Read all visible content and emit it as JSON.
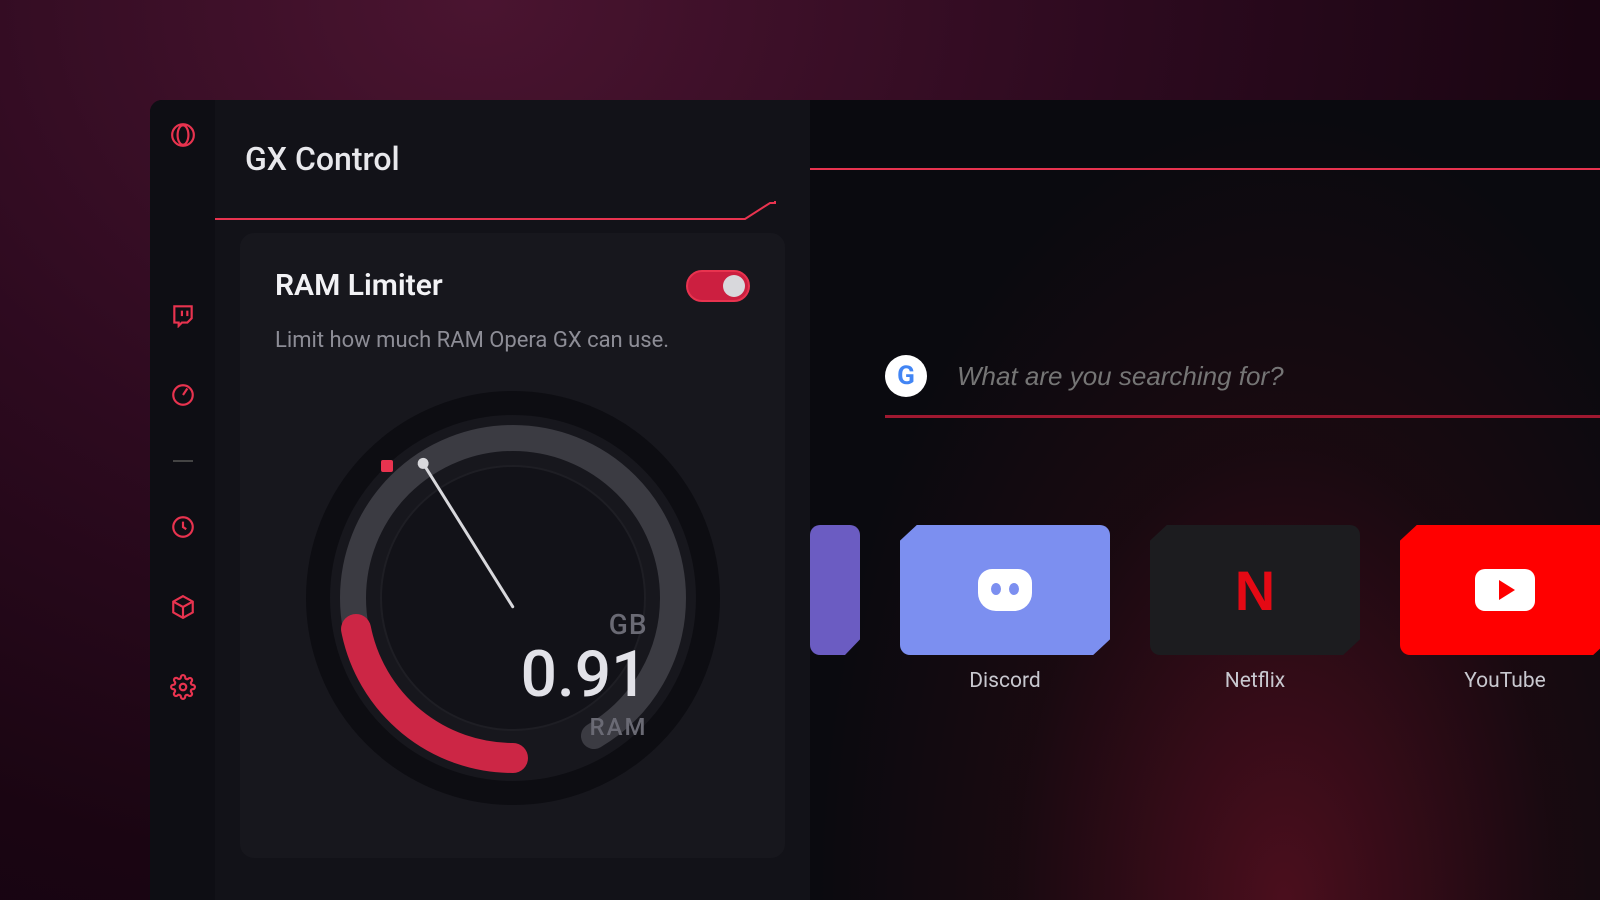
{
  "panel": {
    "title": "GX Control",
    "card": {
      "title": "RAM Limiter",
      "description": "Limit how much RAM Opera GX can use.",
      "toggle_on": true
    },
    "gauge": {
      "unit": "GB",
      "value": "0.91",
      "label": "RAM"
    }
  },
  "search": {
    "placeholder": "What are you searching for?",
    "engine": "google"
  },
  "tiles": [
    {
      "id": "twitch",
      "label": "",
      "partial": true
    },
    {
      "id": "discord",
      "label": "Discord"
    },
    {
      "id": "netflix",
      "label": "Netflix"
    },
    {
      "id": "youtube",
      "label": "YouTube"
    }
  ],
  "colors": {
    "accent": "#e8334f"
  }
}
